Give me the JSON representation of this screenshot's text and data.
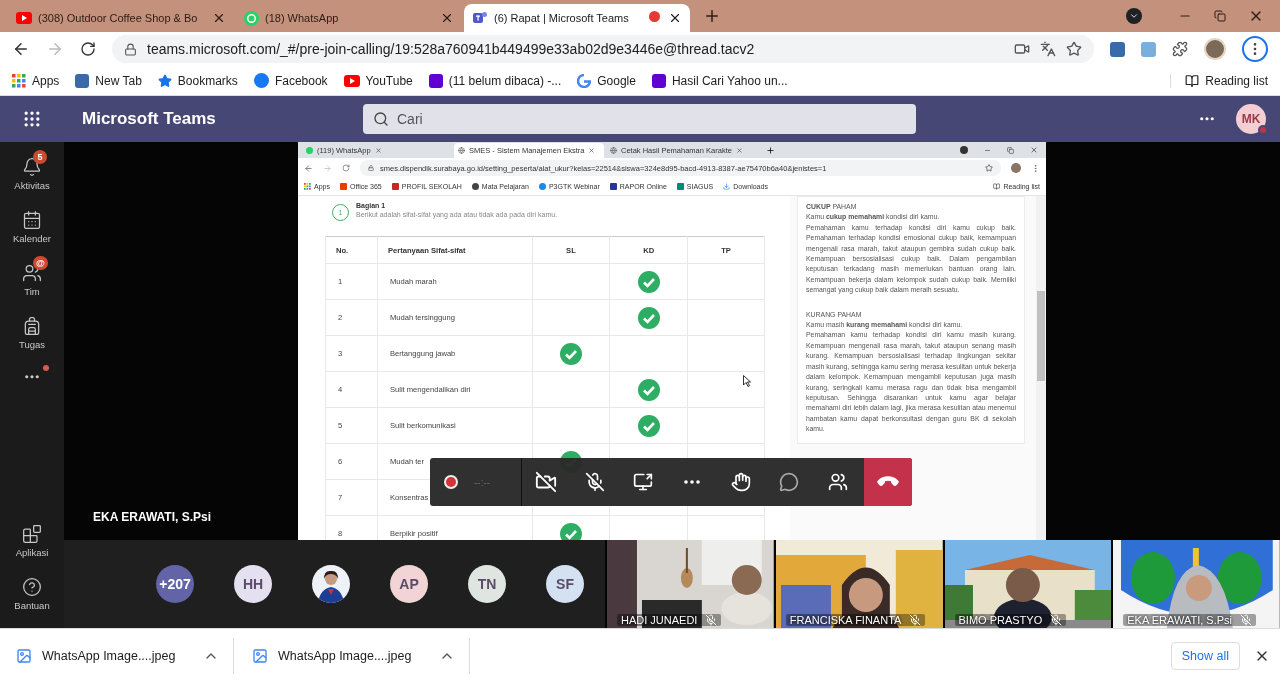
{
  "browser": {
    "tabs": [
      {
        "title": "(308) Outdoor Coffee Shop & Bo",
        "selected": false
      },
      {
        "title": "(18) WhatsApp",
        "selected": false
      },
      {
        "title": "(6) Rapat | Microsoft Teams",
        "selected": true
      }
    ],
    "url": "teams.microsoft.com/_#/pre-join-calling/19:528a760941b449499e33ab02d9e3446e@thread.tacv2",
    "bookmarks": [
      "Apps",
      "New Tab",
      "Bookmarks",
      "Facebook",
      "YouTube",
      "(11 belum dibaca) -...",
      "Google",
      "Hasil Cari Yahoo un..."
    ],
    "reading_list": "Reading list"
  },
  "teams": {
    "title": "Microsoft Teams",
    "search": {
      "placeholder": "Cari"
    },
    "avatar": "MK",
    "rail": [
      {
        "label": "Aktivitas",
        "badge": "5"
      },
      {
        "label": "Kalender"
      },
      {
        "label": "Tim",
        "badge": "@"
      },
      {
        "label": "Tugas"
      }
    ],
    "more_dot": true,
    "rail_bottom": [
      "Aplikasi",
      "Bantuan"
    ],
    "presenter": "EKA ERAWATI, S.Psi",
    "shared_screen": {
      "tabs": [
        {
          "title": "(119) WhatsApp",
          "selected": false
        },
        {
          "title": "SMES - Sistem Manajemen Ekstra",
          "selected": true
        },
        {
          "title": "Cetak Hasil Pemahaman Karakte",
          "selected": false
        }
      ],
      "url": "smes.dispendik.surabaya.go.id/setting_peserta/alat_ukur?kelas=22514&siswa=324e8d95-bacd-4913-8387-ae75470b6a40&jenistes=1",
      "bookmarks": [
        "Apps",
        "Office 365",
        "PROFIL SEKOLAH",
        "Mata Pelajaran",
        "P3GTK Webinar",
        "RAPOR Online",
        "SIAGUS",
        "Downloads"
      ],
      "reading_list": "Reading list",
      "section": {
        "number": "1",
        "title": "Bagian 1",
        "subtitle": "Berikut adalah sifat-sifat yang ada atau tidak ada pada diri kamu."
      },
      "table": {
        "columns": [
          "No.",
          "Pertanyaan Sifat-sifat",
          "SL",
          "KD",
          "TP"
        ],
        "rows": [
          {
            "cells": [
              "1",
              "Mudah marah"
            ],
            "checked": [
              false,
              true,
              false
            ]
          },
          {
            "cells": [
              "2",
              "Mudah tersinggung"
            ],
            "checked": [
              false,
              true,
              false
            ]
          },
          {
            "cells": [
              "3",
              "Bertanggung jawab"
            ],
            "checked": [
              true,
              false,
              false
            ]
          },
          {
            "cells": [
              "4",
              "Sulit mengendalikan diri"
            ],
            "checked": [
              false,
              true,
              false
            ]
          },
          {
            "cells": [
              "5",
              "Sulit berkomunikasi"
            ],
            "checked": [
              false,
              true,
              false
            ]
          },
          {
            "cells": [
              "6",
              "Mudah ter"
            ],
            "checked": [
              true,
              false,
              false
            ]
          },
          {
            "cells": [
              "7",
              "Konsentras"
            ],
            "checked": [
              false,
              false,
              false
            ]
          },
          {
            "cells": [
              "8",
              "Berpikir positif"
            ],
            "checked": [
              true,
              false,
              false
            ]
          }
        ]
      },
      "results": [
        {
          "heading": "**CUKUP** PAHAM",
          "lead": "Kamu **cukup memahami** kondisi diri kamu.",
          "body": "Pemahaman kamu terhadap kondisi diri kamu cukup baik. Pemahaman terhadap kondisi emosional cukup baik, kemampuan mengenali rasa marah, takut ataupun gembira sudah cukup baik. Kemampuan bersosialisasi cukup baik. Dalam pengambilan keputusan terkadang masih memerlukan bantuan orang lain. Kemampuan bekerja dalam kelompok sudah cukup baik. Memiliki semangat yang cukup baik dalam meraih sesuatu."
        },
        {
          "heading": "KURANG PAHAM",
          "lead": "Kamu masih **kurang memahami** kondisi diri kamu.",
          "body": "Pemahaman kamu terhadap kondisi diri kamu masih kurang. Kemampuan mengenali rasa marah, takut ataupun senang masih kurang. Kemampuan bersosialisasi terhadap lingkungan sekitar masih kurang, sehingga kamu sering merasa kesulitan untuk bekerja dalam kelompok. Kemampuan mengambil keputusan juga masih kurang, seringkali kamu merasa ragu dan tidak bisa mengambil keputusan. Sehingga disarankan untuk kamu agar belajar memahami diri lebih dalam lagi, jika merasa kesulitan atau menemui hambatan kamu dapat berkonsultasi dengan guru BK di sekolah kamu."
        }
      ]
    },
    "controls": {
      "timer": "--:--",
      "camera_on": false,
      "mic_on": false
    },
    "roster": [
      {
        "kind": "count",
        "initials": "+207",
        "color": "#6264a7"
      },
      {
        "kind": "initials",
        "initials": "HH",
        "color": "#e4e0f0"
      },
      {
        "kind": "picture"
      },
      {
        "kind": "initials",
        "initials": "AP",
        "color": "#f2d4d7"
      },
      {
        "kind": "initials",
        "initials": "TN",
        "color": "#dfe6e1"
      },
      {
        "kind": "initials",
        "initials": "SF",
        "color": "#d3e1f1"
      }
    ],
    "videos": [
      {
        "name": "HADI JUNAEDI",
        "muted": true
      },
      {
        "name": "FRANCISKA FINANTA",
        "muted": true
      },
      {
        "name": "BIMO PRASTYO",
        "muted": true
      },
      {
        "name": "EKA ERAWATI, S.Psi",
        "muted": true
      }
    ]
  },
  "downloads": {
    "items": [
      "WhatsApp Image....jpeg",
      "WhatsApp Image....jpeg"
    ],
    "show_all": "Show all"
  }
}
